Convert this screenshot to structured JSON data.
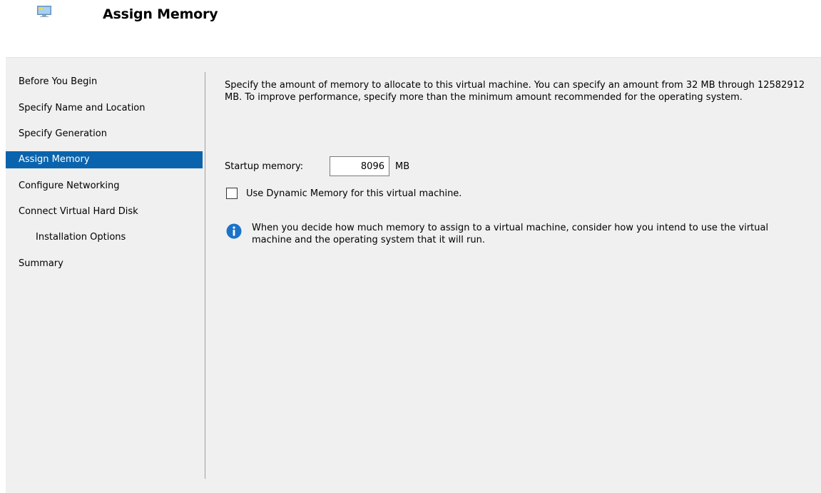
{
  "header": {
    "title": "Assign Memory",
    "icon": "virtual-machine-icon"
  },
  "nav": {
    "items": [
      {
        "label": "Before You Begin"
      },
      {
        "label": "Specify Name and Location"
      },
      {
        "label": "Specify Generation"
      },
      {
        "label": "Assign Memory",
        "selected": true
      },
      {
        "label": "Configure Networking"
      },
      {
        "label": "Connect Virtual Hard Disk"
      },
      {
        "label": "Installation Options"
      },
      {
        "label": "Summary"
      }
    ]
  },
  "main": {
    "description": "Specify the amount of memory to allocate to this virtual machine. You can specify an amount from 32 MB through 12582912 MB. To improve performance, specify more than the minimum amount recommended for the operating system.",
    "startup_memory": {
      "label": "Startup memory:",
      "value": "8096",
      "unit": "MB"
    },
    "dynamic_memory": {
      "label": "Use Dynamic Memory for this virtual machine.",
      "checked": false
    },
    "info": {
      "icon": "info-icon",
      "text": "When you decide how much memory to assign to a virtual machine, consider how you intend to use the virtual machine and the operating system that it will run."
    }
  },
  "colors": {
    "selected_bg": "#0a64ad",
    "panel_bg": "#f0f0f0",
    "info_icon": "#1a73c8"
  }
}
